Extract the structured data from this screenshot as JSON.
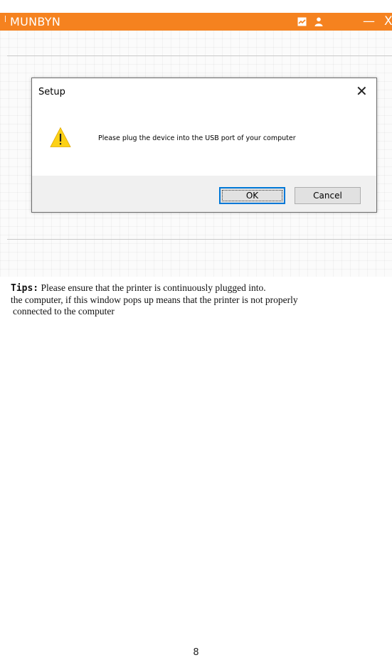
{
  "window": {
    "app_name": "MUNBYN",
    "minimize_glyph": "—",
    "close_glyph": "X",
    "icons": [
      "message-icon",
      "user-icon"
    ],
    "accent_color": "#f5821f"
  },
  "dialog": {
    "title": "Setup",
    "close_glyph": "✕",
    "icon": "warning-icon",
    "message": "Please plug the device into the USB port of your computer",
    "ok_label": "OK",
    "cancel_label": "Cancel"
  },
  "tips": {
    "label": "Tips:",
    "line1": "Please ensure that the printer is continuously plugged into.",
    "line2": "the computer, if this window pops up means that the printer  is not properly",
    "line3": "connected to the computer"
  },
  "page": {
    "number": "8"
  }
}
